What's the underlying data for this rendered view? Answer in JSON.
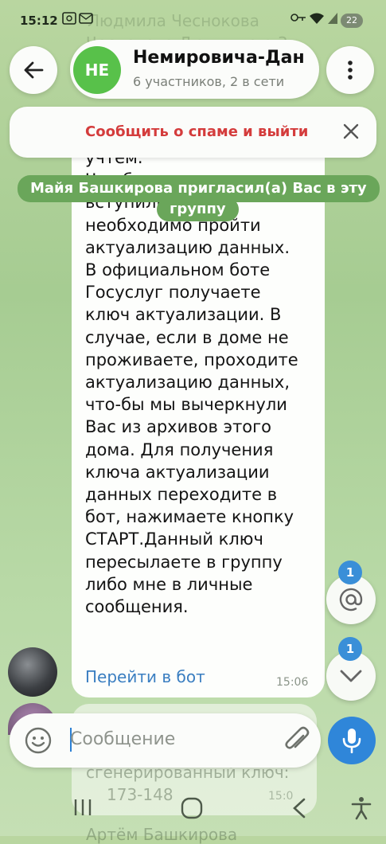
{
  "status_bar": {
    "time": "15:12",
    "battery": "22"
  },
  "background_chat": {
    "top_name": "Людмила Чеснокова",
    "top_line2": "Чеснокова Людмила е 3",
    "bottom_text": "сгенерированный ключ:",
    "bottom_code": "173-148",
    "bottom_time": "15:0",
    "bottom_name": "Артём Башкирова"
  },
  "header": {
    "avatar_initials": "НЕ",
    "title": "Немировича-Дан",
    "subtitle": "6 участников, 2 в сети"
  },
  "spam_bar": {
    "label": "Сообщить о спаме и выйти"
  },
  "system_message": {
    "line1": "Майя Башкирова пригласил(а) Вас в эту",
    "line2": "группу"
  },
  "message": {
    "lines": [
      "учтем.",
      "Что-бы заявки",
      "вступили в силу,",
      "необходимо пройти",
      "актуализацию данных.",
      "В официальном боте",
      "Госуслуг получаете",
      "ключ актуализации. В",
      "случае, если в доме не",
      "проживаете, проходите",
      "актуализацию данных,",
      "что-бы мы вычеркнули",
      "Вас из архивов этого",
      "дома. Для получения",
      "ключа актуализации",
      "данных переходите в",
      "бот, нажимаете кнопку",
      "СТАРТ.Данный ключ",
      "пересылаете в группу",
      "либо мне в личные",
      "сообщения."
    ],
    "link_label": "Перейти в бот",
    "time": "15:06"
  },
  "mentions_badge": "1",
  "scroll_down_badge": "1",
  "input": {
    "placeholder": "Сообщение"
  },
  "colors": {
    "accent": "#2f86d9",
    "spam": "#d43c3c",
    "system_pill": "#6aa65a",
    "avatar": "#58c14a"
  }
}
